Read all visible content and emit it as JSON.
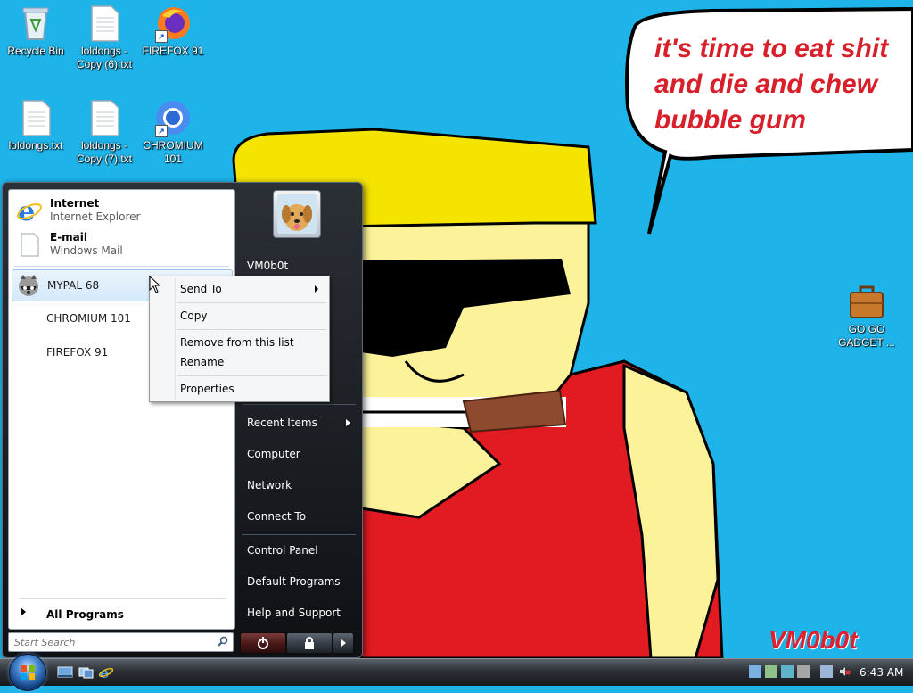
{
  "desktop": {
    "icons": [
      {
        "label": "Recycle Bin"
      },
      {
        "label": "loldongs - Copy (6).txt"
      },
      {
        "label": "FIREFOX 91"
      },
      {
        "label": "loldongs.txt"
      },
      {
        "label": "loldongs - Copy (7).txt"
      },
      {
        "label": "CHROMIUM 101"
      },
      {
        "label": "GO GO GADGET ..."
      }
    ],
    "wallpaper_text": "it's time to eat shit\nand die and chew\nbubble gum",
    "wallpaper_signature": "VM0b0t"
  },
  "start_menu": {
    "pinned": [
      {
        "title": "Internet",
        "subtitle": "Internet Explorer",
        "icon": "internet-explorer-icon"
      },
      {
        "title": "E-mail",
        "subtitle": "Windows Mail",
        "icon": "windows-mail-icon"
      }
    ],
    "recent": [
      {
        "label": "MYPAL 68",
        "icon": "raccoon-icon"
      },
      {
        "label": "CHROMIUM 101"
      },
      {
        "label": "FIREFOX 91"
      }
    ],
    "all_programs": "All Programs",
    "search_placeholder": "Start Search",
    "user_name": "VM0b0t",
    "right_items": [
      "Recent Items",
      "Computer",
      "Network",
      "Connect To",
      "Control Panel",
      "Default Programs",
      "Help and Support"
    ]
  },
  "context_menu": {
    "items": [
      "Send To",
      "Copy",
      "Remove from this list",
      "Rename",
      "Properties"
    ]
  },
  "taskbar": {
    "clock": "6:43 AM"
  },
  "colors": {
    "wallpaper_sky": "#1eb4ea",
    "hat": "#f5e400",
    "skin": "#fbf29a",
    "shirt": "#e21a22",
    "text_red": "#d8202a"
  }
}
